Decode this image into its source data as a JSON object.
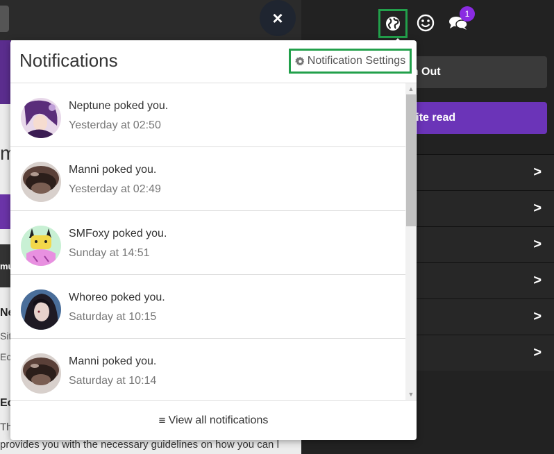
{
  "background": {
    "fragments": {
      "m": "m",
      "ne": "Ne",
      "sit": "Sit",
      "ec": "Ec",
      "ec2": "Ec",
      "th": "Th",
      "mu": "mu"
    },
    "bottom_text": "provides you with the necessary guidelines on how you can l"
  },
  "close_button": {
    "glyph": "×"
  },
  "sidebar": {
    "notification_badge": "1",
    "sign_out_label": "gn Out",
    "mark_read_label": "k site read",
    "rows": [
      ">",
      ">",
      ">",
      ">",
      ">",
      ">"
    ]
  },
  "popup": {
    "title": "Notifications",
    "settings_label": "Notification Settings",
    "footer_label": "View all notifications",
    "items": [
      {
        "message": "Neptune poked you.",
        "time": "Yesterday at 02:50",
        "avatar": "anime-purple-avatar"
      },
      {
        "message": "Manni poked you.",
        "time": "Yesterday at 02:49",
        "avatar": "doorknob-avatar"
      },
      {
        "message": "SMFoxy poked you.",
        "time": "Sunday at 14:51",
        "avatar": "pikachu-avatar"
      },
      {
        "message": "Whoreo poked you.",
        "time": "Saturday at 10:15",
        "avatar": "dark-hair-avatar"
      },
      {
        "message": "Manni poked you.",
        "time": "Saturday at 10:14",
        "avatar": "doorknob-avatar"
      }
    ]
  },
  "colors": {
    "highlight_green": "#22a04b",
    "purple_button": "#6b34b8",
    "badge_purple": "#8a2be2"
  }
}
